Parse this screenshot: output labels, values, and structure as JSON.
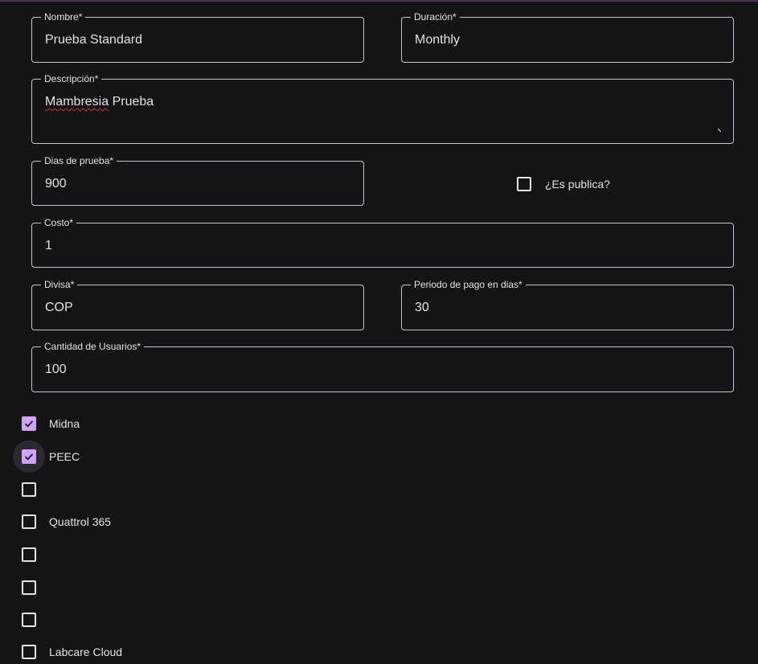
{
  "form": {
    "nombre": {
      "label": "Nombre*",
      "value": "Prueba Standard"
    },
    "duracion": {
      "label": "Duración*",
      "value": "Monthly"
    },
    "descripcion": {
      "label": "Descripción*",
      "value_word1": "Mambresia",
      "value_word2": " Prueba"
    },
    "dias_prueba": {
      "label": "Dias de prueba*",
      "value": "900"
    },
    "es_publica": {
      "label": "¿Es publica?",
      "checked": false
    },
    "costo": {
      "label": "Costo*",
      "value": "1"
    },
    "divisa": {
      "label": "Divisa*",
      "value": "COP"
    },
    "periodo_pago": {
      "label": "Periodo de pago en dias*",
      "value": "30"
    },
    "cantidad_usuarios": {
      "label": "Cantidad de Usuarios*",
      "value": "100"
    }
  },
  "options": [
    {
      "label": "Midna",
      "checked": true
    },
    {
      "label": "PEEC",
      "checked": true
    },
    {
      "label": "",
      "checked": false
    },
    {
      "label": "Quattrol 365",
      "checked": false
    },
    {
      "label": "",
      "checked": false
    },
    {
      "label": "",
      "checked": false
    },
    {
      "label": "",
      "checked": false
    },
    {
      "label": "Labcare Cloud",
      "checked": false
    }
  ],
  "colors": {
    "background": "#141316",
    "checkbox_checked": "#d0a4f5",
    "outline": "#cac4cf"
  },
  "icons": {
    "check": "check-icon",
    "resize": "resize-grip-icon"
  }
}
